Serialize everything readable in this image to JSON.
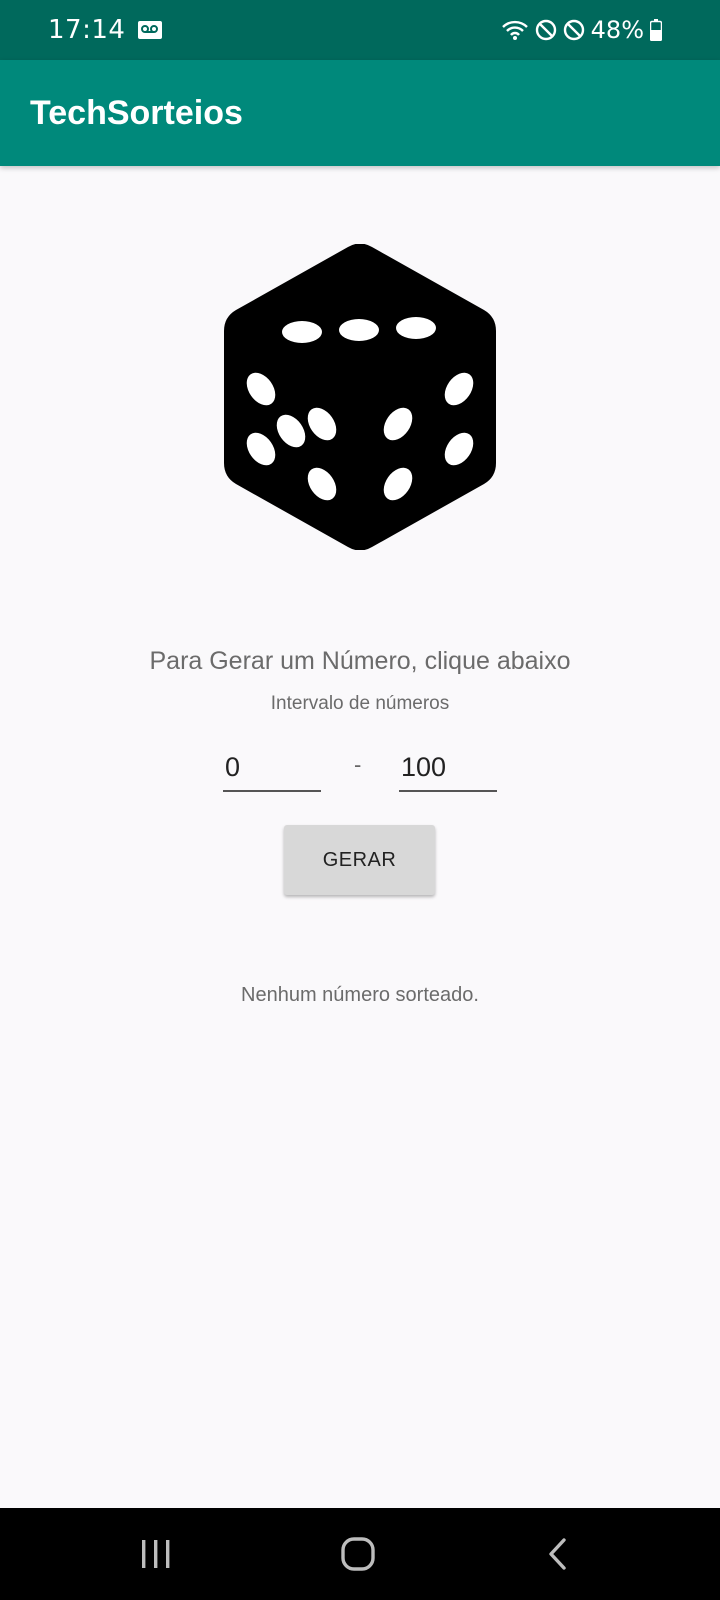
{
  "status_bar": {
    "time": "17:14",
    "battery": "48%",
    "icons": [
      "voicemail-icon",
      "wifi-icon",
      "do-not-disturb-icon",
      "blocked-icon",
      "battery-icon"
    ]
  },
  "app_bar": {
    "title": "TechSorteios"
  },
  "main": {
    "dice_icon": "dice-icon",
    "headline": "Para Gerar um Número, clique abaixo",
    "range_label": "Intervalo de números",
    "range_min": "0",
    "range_max": "100",
    "separator": "-",
    "generate_label": "GERAR",
    "result_text": "Nenhum número sorteado."
  },
  "nav_bar": {
    "icons": [
      "recents-icon",
      "home-icon",
      "back-icon"
    ]
  },
  "colors": {
    "status_bar": "#00695c",
    "app_bar": "#00897b",
    "background": "#faf9fb",
    "button": "#d8d8d8"
  }
}
